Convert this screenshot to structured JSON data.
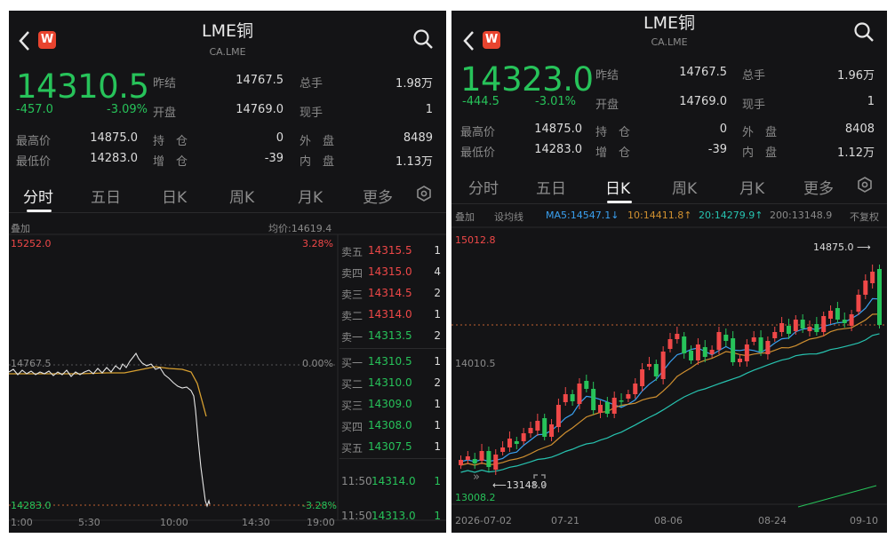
{
  "left": {
    "title": "LME铜",
    "code": "CA.LME",
    "price": "14310.5",
    "change": "-457.0",
    "change_pct": "-3.09%",
    "stats": {
      "prev_close_label": "昨结",
      "prev_close": "14767.5",
      "volume_label": "总手",
      "volume": "1.98万",
      "open_label": "开盘",
      "open": "14769.0",
      "current_label": "现手",
      "current": "1",
      "high_label": "最高价",
      "high": "14875.0",
      "hold_label": "持　仓",
      "hold": "0",
      "outer_label": "外　盘",
      "outer": "8489",
      "low_label": "最低价",
      "low": "14283.0",
      "add_label": "增　仓",
      "add": "-39",
      "inner_label": "内　盘",
      "inner": "1.13万"
    },
    "tabs": [
      "分时",
      "五日",
      "日K",
      "周K",
      "月K",
      "更多"
    ],
    "overlay_label": "叠加",
    "avg_price": "均价:14619.4",
    "chart": {
      "top_price": "15252.0",
      "top_pct": "3.28%",
      "mid_price": "14767.5",
      "mid_pct": "0.00%",
      "bottom_price": "14283.0",
      "bottom_pct": "-3.28%",
      "times": [
        "1:00",
        "5:30",
        "10:00",
        "14:30",
        "19:00"
      ]
    },
    "orderbook": {
      "asks": [
        {
          "label": "卖五",
          "price": "14315.5",
          "qty": "1"
        },
        {
          "label": "卖四",
          "price": "14315.0",
          "qty": "4"
        },
        {
          "label": "卖三",
          "price": "14314.5",
          "qty": "2"
        },
        {
          "label": "卖二",
          "price": "14314.0",
          "qty": "1"
        },
        {
          "label": "卖一",
          "price": "14313.5",
          "qty": "2"
        }
      ],
      "bids": [
        {
          "label": "买一",
          "price": "14310.5",
          "qty": "1"
        },
        {
          "label": "买二",
          "price": "14310.0",
          "qty": "2"
        },
        {
          "label": "买三",
          "price": "14309.0",
          "qty": "1"
        },
        {
          "label": "买四",
          "price": "14308.0",
          "qty": "1"
        },
        {
          "label": "买五",
          "price": "14307.5",
          "qty": "1"
        }
      ],
      "trades": [
        {
          "time": "11:50",
          "price": "14314.0",
          "qty": "1"
        },
        {
          "time": "11:50",
          "price": "14313.0",
          "qty": "1"
        }
      ]
    }
  },
  "right": {
    "title": "LME铜",
    "code": "CA.LME",
    "price": "14323.0",
    "change": "-444.5",
    "change_pct": "-3.01%",
    "stats": {
      "prev_close_label": "昨结",
      "prev_close": "14767.5",
      "volume_label": "总手",
      "volume": "1.96万",
      "open_label": "开盘",
      "open": "14769.0",
      "current_label": "现手",
      "current": "1",
      "high_label": "最高价",
      "high": "14875.0",
      "hold_label": "持　仓",
      "hold": "0",
      "outer_label": "外　盘",
      "outer": "8408",
      "low_label": "最低价",
      "low": "14283.0",
      "add_label": "增　仓",
      "add": "-39",
      "inner_label": "内　盘",
      "inner": "1.12万"
    },
    "tabs": [
      "分时",
      "五日",
      "日K",
      "周K",
      "月K",
      "更多"
    ],
    "ind": {
      "overlay": "叠加",
      "line": "设均线",
      "ma5": "MA5:14547.1↓",
      "ma10": "10:14411.8↑",
      "ma20": "20:14279.9↑",
      "ma200": "200:13148.9",
      "adj": "不复权"
    },
    "chart": {
      "top_price": "15012.8",
      "mid_price": "14010.5",
      "bottom_price": "13008.2",
      "high_mark": "14875.0",
      "low_mark": "13148.0",
      "dates": [
        "2026-07-02",
        "07-21",
        "08-06",
        "08-24",
        "09-10"
      ]
    }
  },
  "colors": {
    "up": "#f04848",
    "down": "#27c35a",
    "bg": "#141416",
    "ma5": "#3aa0f0",
    "ma10": "#d09030",
    "ma20": "#27c3b0",
    "price_line": "#e0e0e0",
    "avg_line": "#d8a030"
  },
  "icons": [
    "back-arrow-icon",
    "app-logo-icon",
    "search-icon",
    "settings-icon",
    "expand-icon",
    "collapse-icon"
  ]
}
